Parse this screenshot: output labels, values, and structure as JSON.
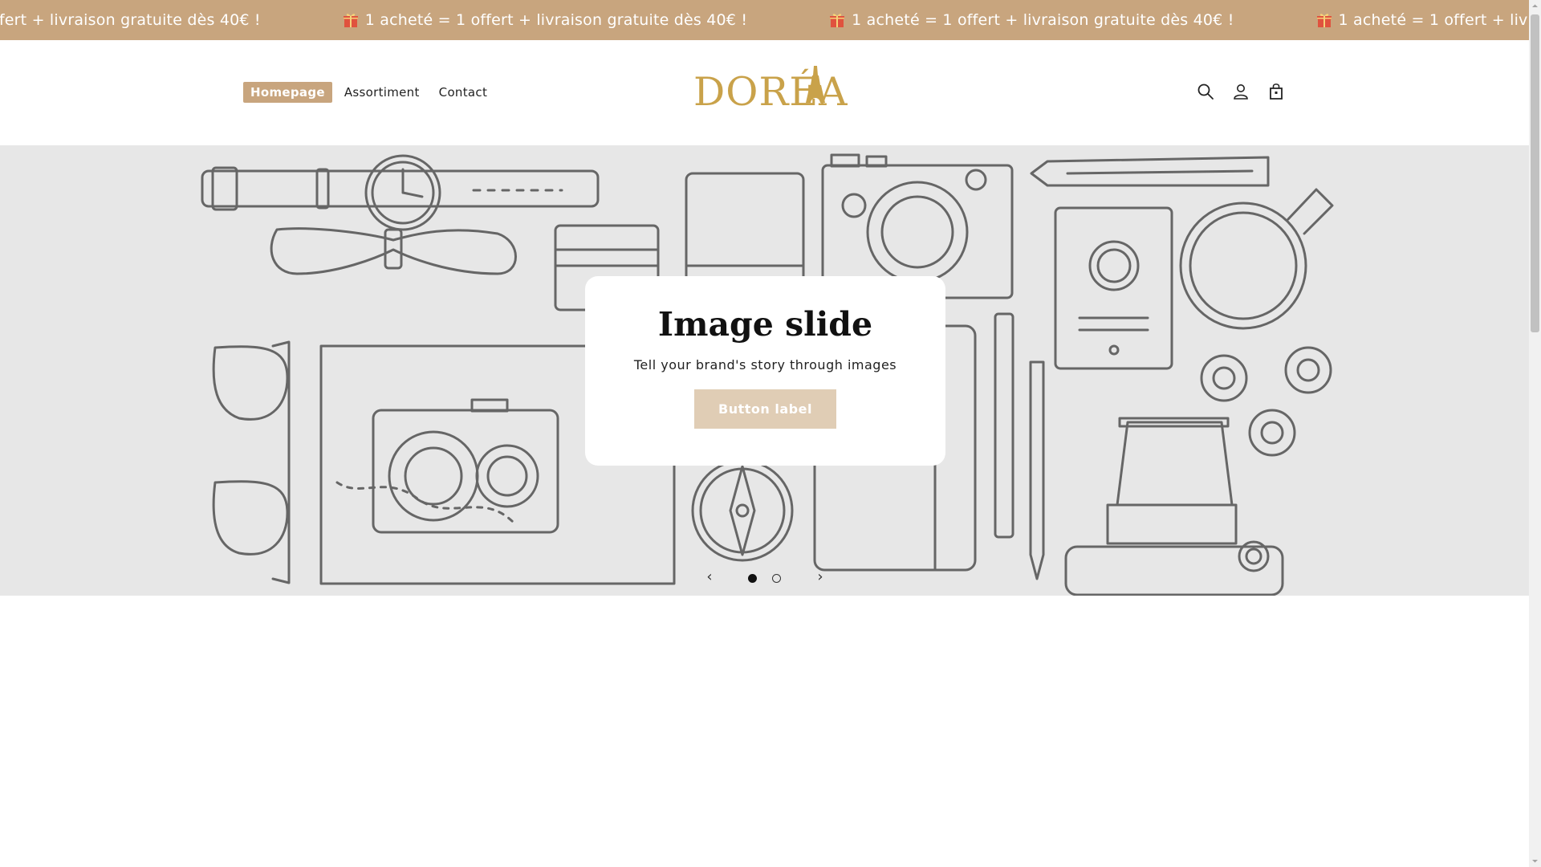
{
  "announcement": {
    "text": "1 acheté = 1 offert + livraison gratuite dès 40€ !",
    "text_cut": "ffert + livraison gratuite dès 40€ !",
    "text_cut_end": "1 acheté = 1 offert + livraison gratu",
    "icon": "gift-icon",
    "background": "#c8a57e"
  },
  "header": {
    "nav": [
      {
        "label": "Homepage",
        "active": true
      },
      {
        "label": "Assortiment",
        "active": false
      },
      {
        "label": "Contact",
        "active": false
      }
    ],
    "logo_text": "DORÉA",
    "logo_color": "#c9a24a",
    "icons": [
      "search-icon",
      "account-icon",
      "cart-icon"
    ]
  },
  "slideshow": {
    "title": "Image slide",
    "subtitle": "Tell your brand's story through images",
    "button_label": "Button label",
    "prev_glyph": "‹",
    "next_glyph": "›",
    "slide_count": 2,
    "current_slide": 1
  },
  "colors": {
    "accent": "#c8a57e",
    "button": "#e0cdb5",
    "slide_bg": "#e7e7e7"
  }
}
